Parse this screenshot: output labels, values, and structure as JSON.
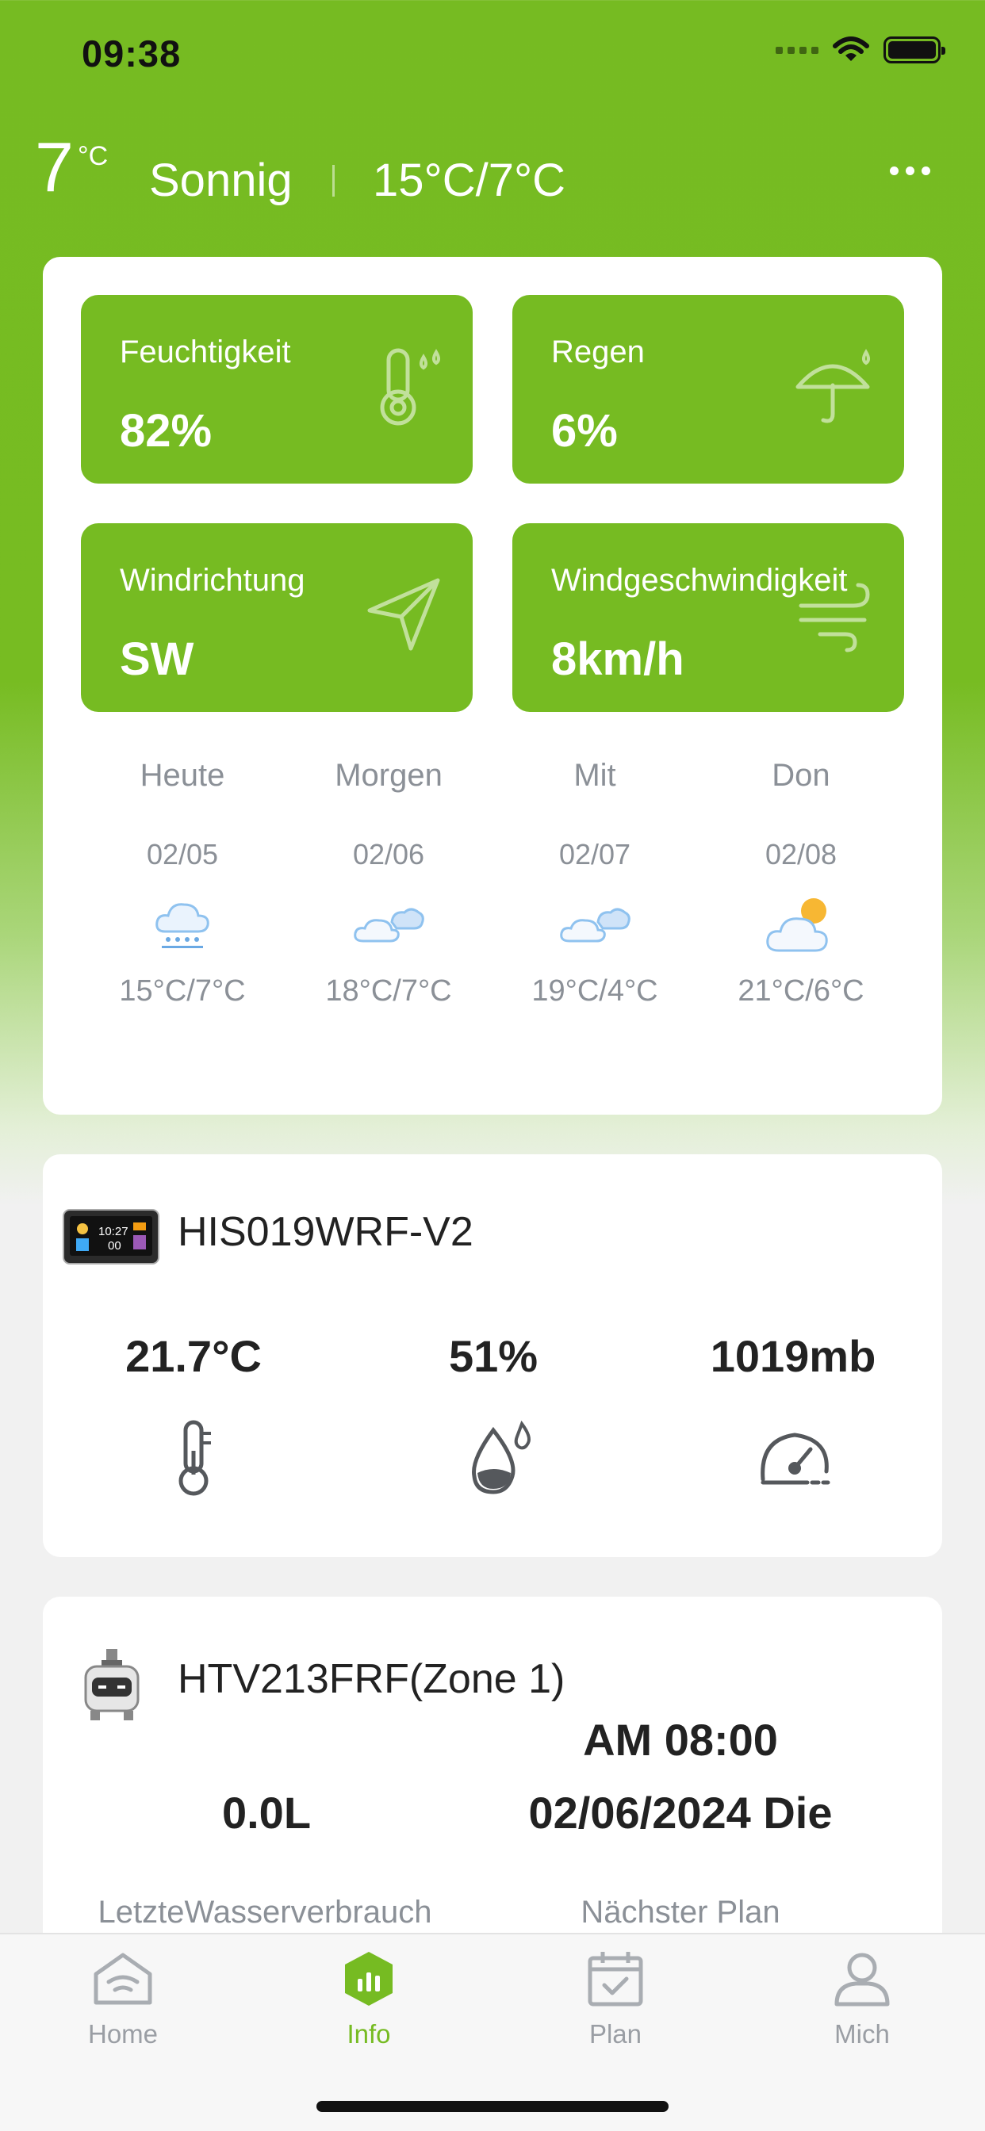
{
  "status_bar": {
    "time": "09:38"
  },
  "header": {
    "temperature": "7",
    "unit": "°C",
    "condition": "Sonnig",
    "range": "15°C/7°C"
  },
  "tiles": [
    {
      "label": "Feuchtigkeit",
      "value": "82%",
      "icon": "thermometer-drops-icon"
    },
    {
      "label": "Regen",
      "value": "6%",
      "icon": "umbrella-icon"
    },
    {
      "label": "Windrichtung",
      "value": "SW",
      "icon": "navigation-arrow-icon"
    },
    {
      "label": "Windgeschwindigkeit",
      "value": "8km/h",
      "icon": "wind-icon"
    }
  ],
  "forecast": [
    {
      "day": "Heute",
      "date": "02/05",
      "icon": "snow-cloud-icon",
      "range": "15°C/7°C"
    },
    {
      "day": "Morgen",
      "date": "02/06",
      "icon": "cloudy-icon",
      "range": "18°C/7°C"
    },
    {
      "day": "Mit",
      "date": "02/07",
      "icon": "cloudy-icon",
      "range": "19°C/4°C"
    },
    {
      "day": "Don",
      "date": "02/08",
      "icon": "partly-sunny-icon",
      "range": "21°C/6°C"
    }
  ],
  "device1": {
    "name": "HIS019WRF-V2",
    "temperature": "21.7°C",
    "humidity": "51%",
    "pressure": "1019mb"
  },
  "device2": {
    "name": "HTV213FRF(Zone 1)",
    "water_value": "0.0L",
    "water_label": "LetzteWasserverbrauch",
    "plan_time": "AM 08:00",
    "plan_date": "02/06/2024 Die",
    "plan_label": "Nächster Plan"
  },
  "nav": [
    {
      "label": "Home",
      "icon": "home-icon"
    },
    {
      "label": "Info",
      "icon": "info-chart-icon",
      "active": true
    },
    {
      "label": "Plan",
      "icon": "calendar-icon"
    },
    {
      "label": "Mich",
      "icon": "person-icon"
    }
  ],
  "colors": {
    "accent": "#76bb22",
    "text_muted": "#8b9097"
  }
}
